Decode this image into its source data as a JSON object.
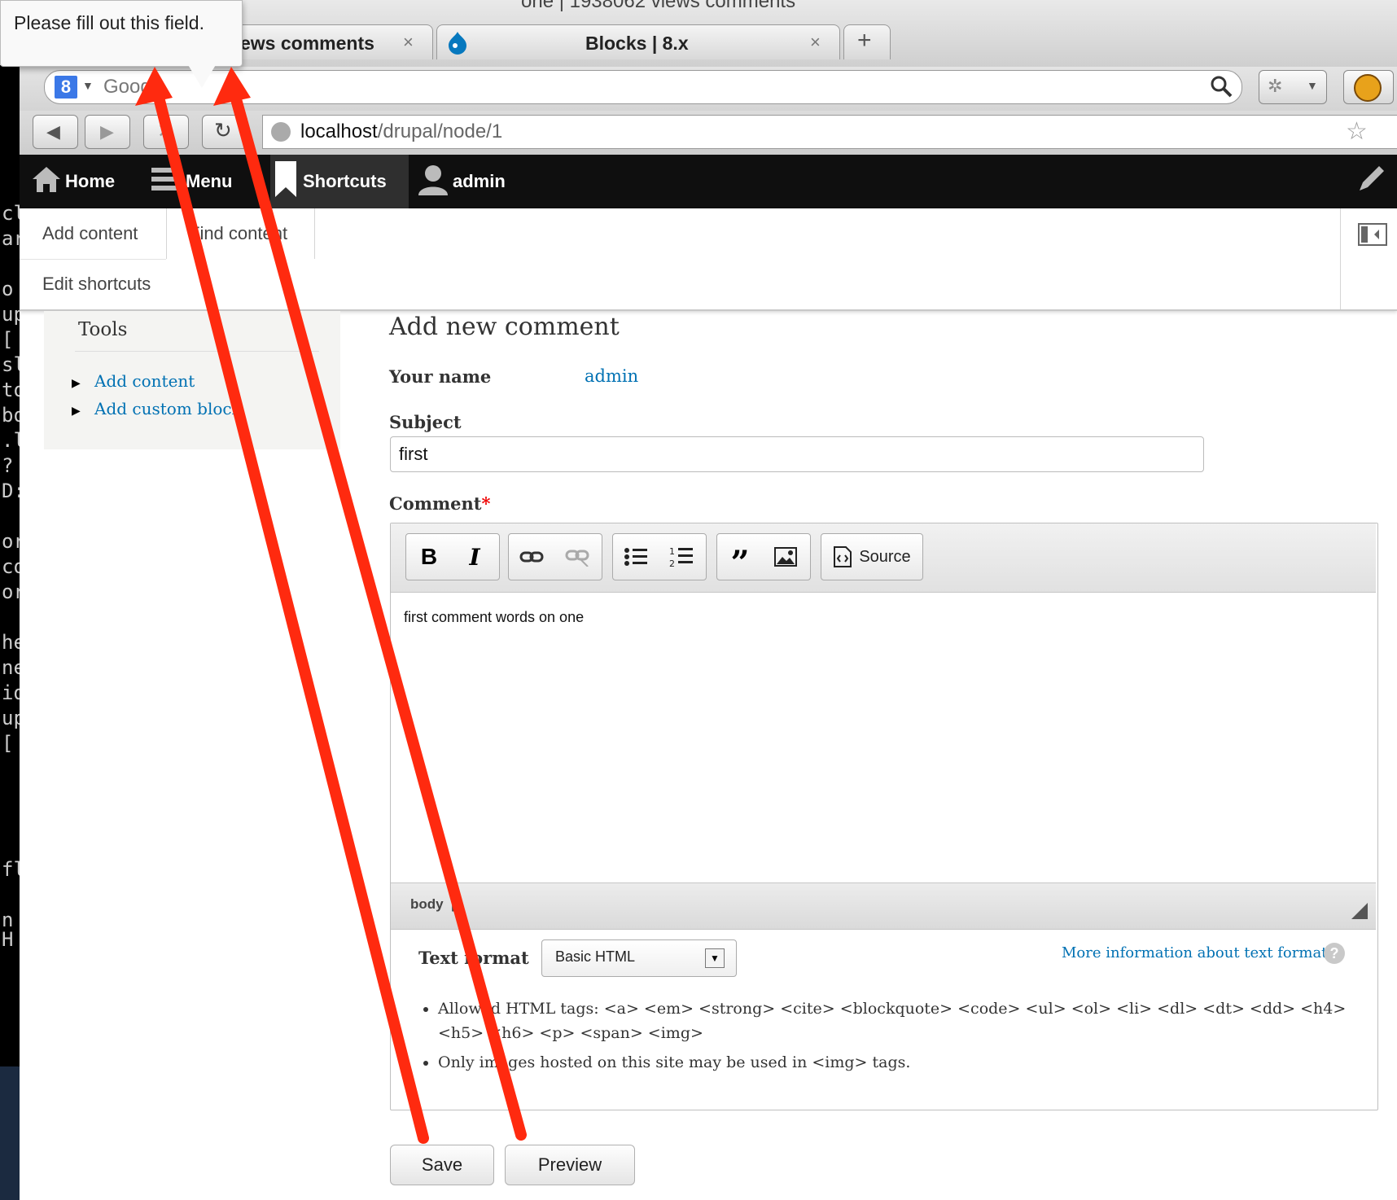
{
  "browser": {
    "window_title": "one | 1938062 views comments",
    "tabs": [
      {
        "title": "ews comments"
      },
      {
        "title": "Blocks | 8.x"
      }
    ],
    "new_tab_label": "+",
    "tab_close_glyph": "×",
    "search_placeholder": "Goog",
    "url_host": "localhost",
    "url_path": "/drupal/node/1"
  },
  "validation_tooltip": "Please fill out this field.",
  "terminal": {
    "lines": [
      "cl",
      "ar",
      "",
      "o",
      "up",
      "[",
      "sl",
      "to",
      "bo",
      ".l",
      "?",
      "D:",
      "",
      "or",
      "co",
      "or",
      "",
      "he",
      "ne",
      "id",
      "up",
      "[",
      "",
      "",
      "",
      "",
      "fla",
      "",
      "n H"
    ]
  },
  "drupal_toolbar": {
    "home": "Home",
    "menu": "Menu",
    "shortcuts": "Shortcuts",
    "user": "admin"
  },
  "shortcuts_tray": {
    "links": [
      "Add content",
      "Find content",
      "Edit shortcuts"
    ]
  },
  "sidebar": {
    "title": "Tools",
    "links": [
      "Add content",
      "Add custom block"
    ]
  },
  "comment_form": {
    "heading": "Add new comment",
    "your_name_label": "Your name",
    "your_name_value": "admin",
    "subject_label": "Subject",
    "subject_value": "first",
    "comment_label": "Comment",
    "required_mark": "*",
    "source_label": "Source",
    "body_text": "first comment words on one",
    "status_path": "body  p",
    "text_format_label": "Text format",
    "text_format_value": "Basic HTML",
    "more_info_link": "More information about text formats",
    "tips": [
      "Allowed HTML tags: <a> <em> <strong> <cite> <blockquote> <code> <ul> <ol> <li> <dl> <dt> <dd> <h4> <h5> <h6> <p> <span> <img>",
      "Only images hosted on this site may be used in <img> tags."
    ],
    "save_label": "Save",
    "preview_label": "Preview"
  },
  "colors": {
    "link": "#0071b3",
    "annotation_arrow": "#ff2a0f",
    "toolbar_bg": "#0f0f0f"
  }
}
